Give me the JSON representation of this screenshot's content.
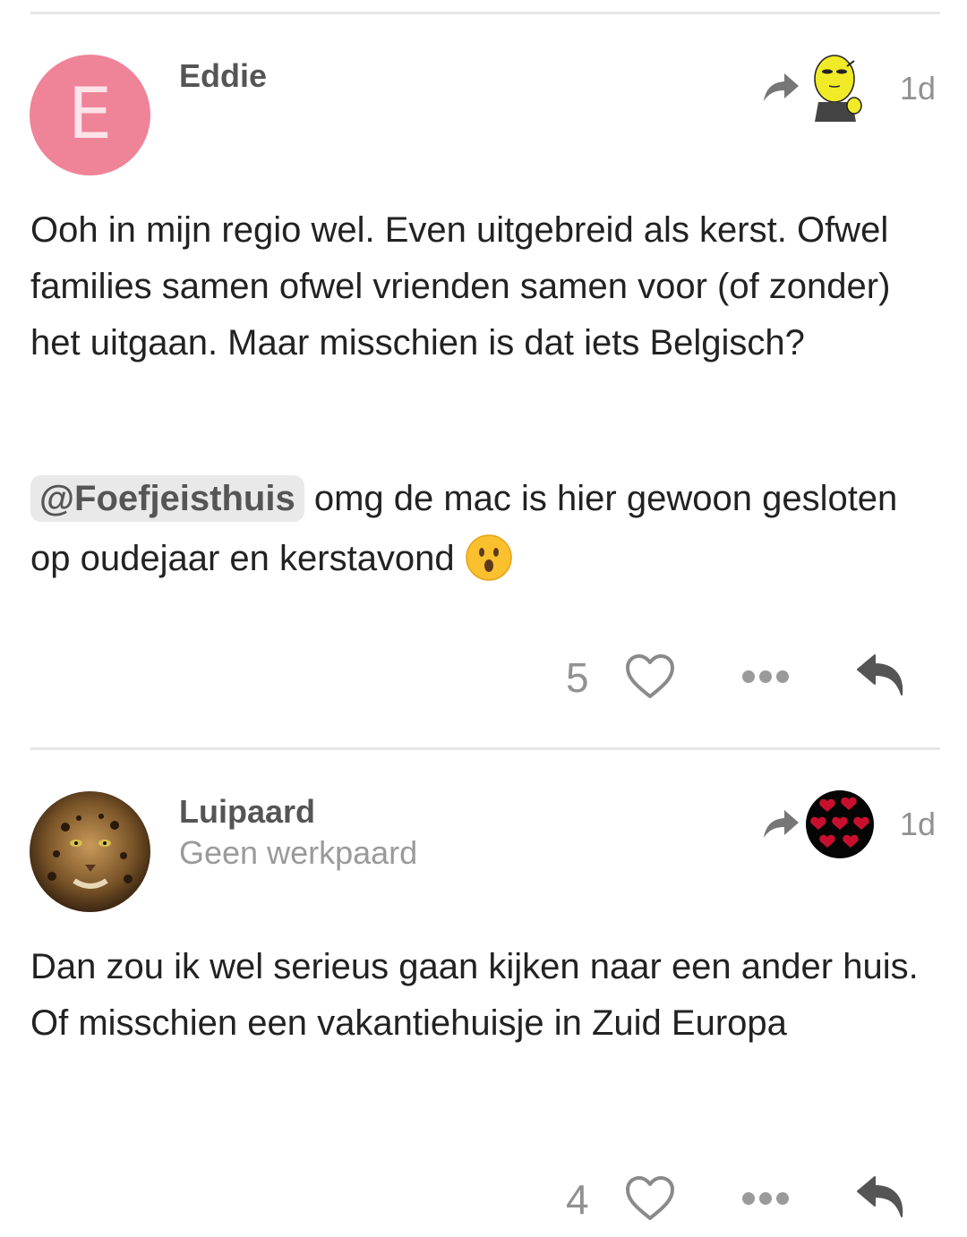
{
  "posts": [
    {
      "avatar_letter": "E",
      "username": "Eddie",
      "user_title": "",
      "date": "1d",
      "body_paragraph_1": "Ooh in mijn regio wel. Even uitgebreid als kerst. Ofwel families samen ofwel vrienden samen voor (of zonder) het uitgaan. Maar misschien is dat iets Belgisch?",
      "mention": "@Foefjeisthuis",
      "body_paragraph_2": " omg de mac is hier gewoon gesloten op oudejaar en kerstavond",
      "emoji": "astonished-face-emoji",
      "like_count": "5"
    },
    {
      "username": "Luipaard",
      "user_title": "Geen werkpaard",
      "date": "1d",
      "body_paragraph_1": "Dan zou ik wel serieus gaan kijken naar een ander huis. Of misschien een vakantiehuisje in Zuid Europa",
      "like_count": "4"
    }
  ],
  "icons": {
    "share": "share-arrow-icon",
    "like": "heart-icon",
    "more": "more-dots-icon",
    "reply": "reply-arrow-icon"
  },
  "colors": {
    "avatar_e": "#ef8397",
    "mention_bg": "#e9e9e9",
    "muted": "#919191"
  }
}
